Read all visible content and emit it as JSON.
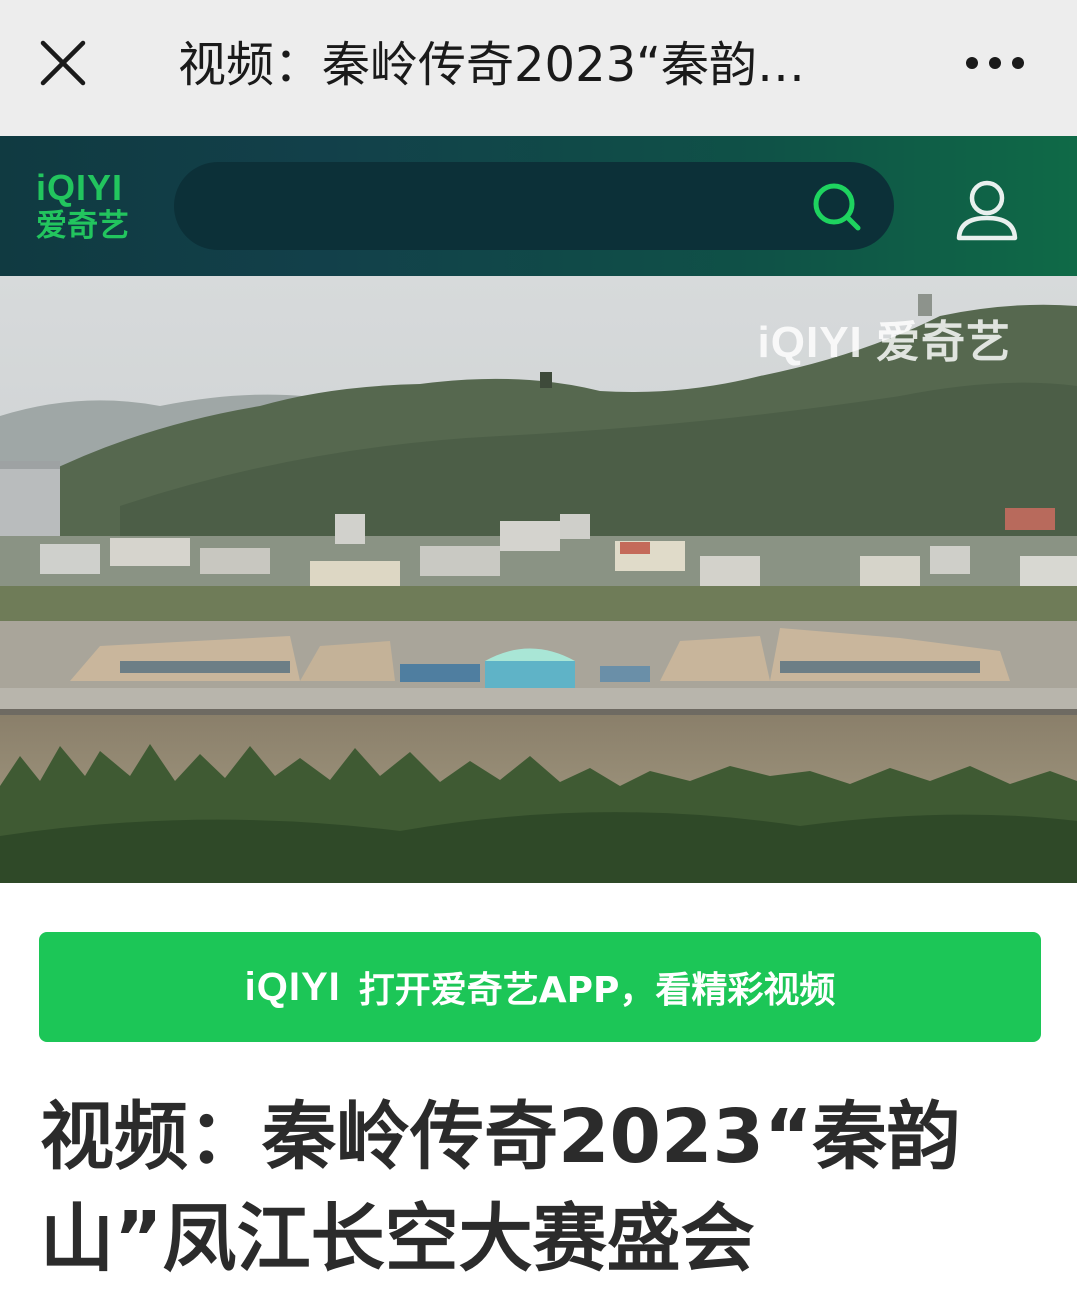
{
  "nav": {
    "title": "视频：秦岭传奇2023“秦韵…",
    "close_icon": "close-icon",
    "more_icon": "more-dots-icon"
  },
  "header": {
    "logo_en": "iQIYI",
    "logo_cn": "爱奇艺",
    "search_icon": "search-icon",
    "user_icon": "user-icon",
    "accent": "#22c55e"
  },
  "video": {
    "watermark": "iQIYI 爱奇艺"
  },
  "open_app": {
    "brand": "iQIYI",
    "label": "打开爱奇艺APP，看精彩视频",
    "color": "#1cc657"
  },
  "article": {
    "title": "视频：秦岭传奇2023“秦韵山”凤江长空大赛盛会"
  }
}
